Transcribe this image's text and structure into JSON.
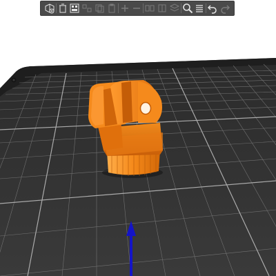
{
  "app": {
    "view": "3D plater"
  },
  "toolbar": {
    "buttons": [
      {
        "icon": "add-object-icon",
        "enabled": true
      },
      {
        "icon": "delete-icon",
        "enabled": true
      },
      {
        "icon": "delete-all-icon",
        "enabled": true
      },
      {
        "icon": "arrange-icon",
        "enabled": false
      },
      {
        "icon": "copy-icon",
        "enabled": false
      },
      {
        "icon": "paste-icon",
        "enabled": false
      },
      {
        "icon": "add-instance-icon",
        "enabled": false
      },
      {
        "icon": "remove-instance-icon",
        "enabled": false
      },
      {
        "icon": "split-objects-icon",
        "enabled": false
      },
      {
        "icon": "split-parts-icon",
        "enabled": false
      },
      {
        "icon": "layers-editing-icon",
        "enabled": false
      },
      {
        "icon": "search-icon",
        "enabled": true
      },
      {
        "icon": "settings-icon",
        "enabled": true
      },
      {
        "icon": "undo-icon",
        "enabled": true
      },
      {
        "icon": "redo-icon",
        "enabled": false
      }
    ]
  },
  "scene": {
    "background_color": "#ffffff",
    "bed_color": "#2a2a2a",
    "grid_color": "#8a8a8a",
    "model_color": "#f07b12",
    "axis_color": "#1414c8"
  }
}
